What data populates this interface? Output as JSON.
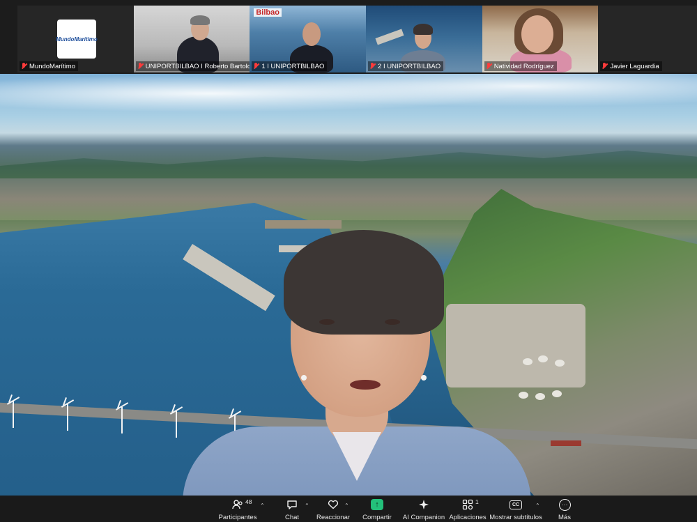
{
  "gallery": {
    "tiles": [
      {
        "name": "MundoMarítimo",
        "logo_text": "MundoMarítimo",
        "muted": true
      },
      {
        "name": "UNIPORTBILBAO I Roberto Bartolomé",
        "muted": true
      },
      {
        "name": "1 I UNIPORTBILBAO",
        "muted": true,
        "overlay_text": "Bilbao"
      },
      {
        "name": "2 I UNIPORTBILBAO",
        "muted": true
      },
      {
        "name": "Natividad Rodríguez",
        "muted": true
      },
      {
        "name": "Javier Laguardia",
        "muted": true
      }
    ]
  },
  "toolbar": {
    "participants": {
      "label": "Participantes",
      "count": "48",
      "icon": "participants-icon"
    },
    "chat": {
      "label": "Chat",
      "icon": "chat-icon"
    },
    "react": {
      "label": "Reaccionar",
      "icon": "heart-icon"
    },
    "share": {
      "label": "Compartir",
      "icon": "share-arrow-icon"
    },
    "companion": {
      "label": "AI Companion",
      "icon": "sparkle-icon"
    },
    "apps": {
      "label": "Aplicaciones",
      "count": "1",
      "icon": "apps-icon"
    },
    "captions": {
      "label": "Mostrar subtítulos",
      "icon": "cc-icon",
      "icon_text": "CC"
    },
    "more": {
      "label": "Más",
      "icon": "more-icon",
      "icon_text": "···"
    }
  },
  "colors": {
    "toolbar_bg": "#1a1a1a",
    "share_green": "#23c07a",
    "muted_red": "#ff3b3b"
  }
}
